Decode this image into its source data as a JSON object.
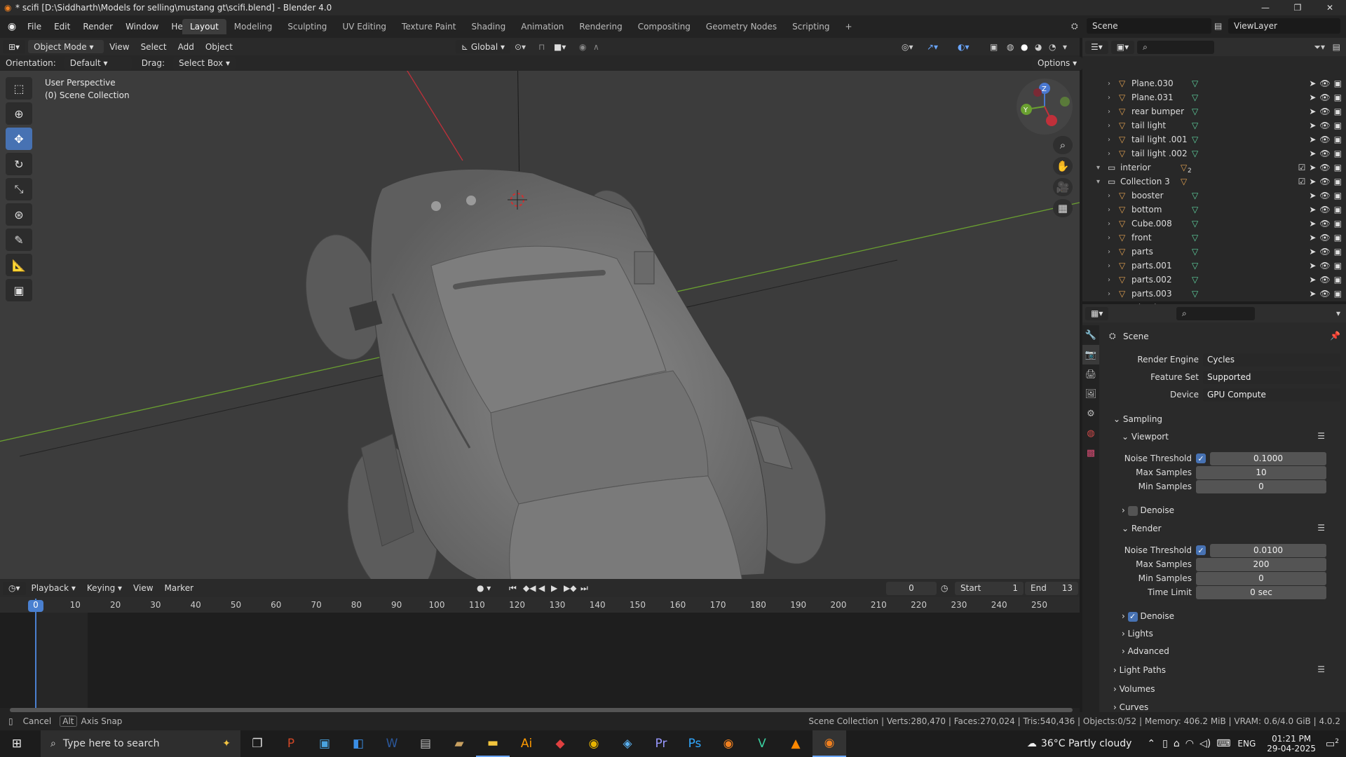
{
  "window": {
    "title": "* scifi [D:\\Siddharth\\Models for selling\\mustang gt\\scifi.blend] - Blender 4.0"
  },
  "menu": {
    "items": [
      "File",
      "Edit",
      "Render",
      "Window",
      "Help"
    ]
  },
  "workspaces": [
    "Layout",
    "Modeling",
    "Sculpting",
    "UV Editing",
    "Texture Paint",
    "Shading",
    "Animation",
    "Rendering",
    "Compositing",
    "Geometry Nodes",
    "Scripting"
  ],
  "scene": {
    "name": "Scene",
    "view_layer": "ViewLayer"
  },
  "viewport_header": {
    "mode": "Object Mode",
    "items": [
      "View",
      "Select",
      "Add",
      "Object"
    ],
    "transform": "Global"
  },
  "tool_settings": {
    "orientation_label": "Orientation:",
    "orientation": "Default",
    "drag_label": "Drag:",
    "drag": "Select Box",
    "options": "Options"
  },
  "viewport": {
    "perspective": "User Perspective",
    "collection": "(0) Scene Collection"
  },
  "outliner": {
    "rows": [
      {
        "name": "Plane.030",
        "indent": 2,
        "kind": "mesh"
      },
      {
        "name": "Plane.031",
        "indent": 2,
        "kind": "mesh"
      },
      {
        "name": "rear bumper",
        "indent": 2,
        "kind": "mesh"
      },
      {
        "name": "tail light",
        "indent": 2,
        "kind": "mesh"
      },
      {
        "name": "tail light .001",
        "indent": 2,
        "kind": "mesh"
      },
      {
        "name": "tail light .002",
        "indent": 2,
        "kind": "mesh"
      },
      {
        "name": "interior",
        "indent": 1,
        "kind": "collection",
        "badge": "2"
      },
      {
        "name": "Collection 3",
        "indent": 1,
        "kind": "collection"
      },
      {
        "name": "booster",
        "indent": 2,
        "kind": "mesh"
      },
      {
        "name": "bottom",
        "indent": 2,
        "kind": "mesh"
      },
      {
        "name": "Cube.008",
        "indent": 2,
        "kind": "mesh"
      },
      {
        "name": "front",
        "indent": 2,
        "kind": "mesh"
      },
      {
        "name": "parts",
        "indent": 2,
        "kind": "mesh"
      },
      {
        "name": "parts.001",
        "indent": 2,
        "kind": "mesh"
      },
      {
        "name": "parts.002",
        "indent": 2,
        "kind": "mesh"
      },
      {
        "name": "parts.003",
        "indent": 2,
        "kind": "mesh"
      },
      {
        "name": "wheels",
        "indent": 2,
        "kind": "mesh"
      }
    ]
  },
  "properties": {
    "context": "Scene",
    "render_engine_label": "Render Engine",
    "render_engine": "Cycles",
    "feature_set_label": "Feature Set",
    "feature_set": "Supported",
    "device_label": "Device",
    "device": "GPU Compute",
    "sampling": "Sampling",
    "viewport": "Viewport",
    "noise_threshold_label": "Noise Threshold",
    "vp_noise_threshold": "0.1000",
    "max_samples_label": "Max Samples",
    "vp_max_samples": "10",
    "min_samples_label": "Min Samples",
    "vp_min_samples": "0",
    "denoise": "Denoise",
    "render": "Render",
    "r_noise_threshold": "0.0100",
    "r_max_samples": "200",
    "r_min_samples": "0",
    "time_limit_label": "Time Limit",
    "r_time_limit": "0 sec",
    "lights": "Lights",
    "advanced": "Advanced",
    "light_paths": "Light Paths",
    "volumes": "Volumes",
    "curves": "Curves"
  },
  "timeline": {
    "menus": [
      "Playback",
      "Keying",
      "View",
      "Marker"
    ],
    "current_frame": "0",
    "start_label": "Start",
    "start": "1",
    "end_label": "End",
    "end": "13",
    "ticks": [
      "0",
      "10",
      "20",
      "30",
      "40",
      "50",
      "60",
      "70",
      "80",
      "90",
      "100",
      "110",
      "120",
      "130",
      "140",
      "150",
      "160",
      "170",
      "180",
      "190",
      "200",
      "210",
      "220",
      "230",
      "240",
      "250"
    ]
  },
  "statusbar": {
    "cancel": "Cancel",
    "alt": "Alt",
    "axis_snap": "Axis Snap",
    "stats": "Scene Collection | Verts:280,470 | Faces:270,024 | Tris:540,436 | Objects:0/52 | Memory: 406.2 MiB | VRAM: 0.6/4.0 GiB | 4.0.2"
  },
  "taskbar": {
    "search_placeholder": "Type here to search",
    "weather": "36°C  Partly cloudy",
    "lang": "ENG",
    "time": "01:21 PM",
    "date": "29-04-2025",
    "notif": "2"
  },
  "colors": {
    "accent": "#4772b3",
    "mesh_icon": "#e0a050",
    "data_icon": "#5fd3a0",
    "x_axis": "#c0303a",
    "y_axis": "#6aa030"
  }
}
